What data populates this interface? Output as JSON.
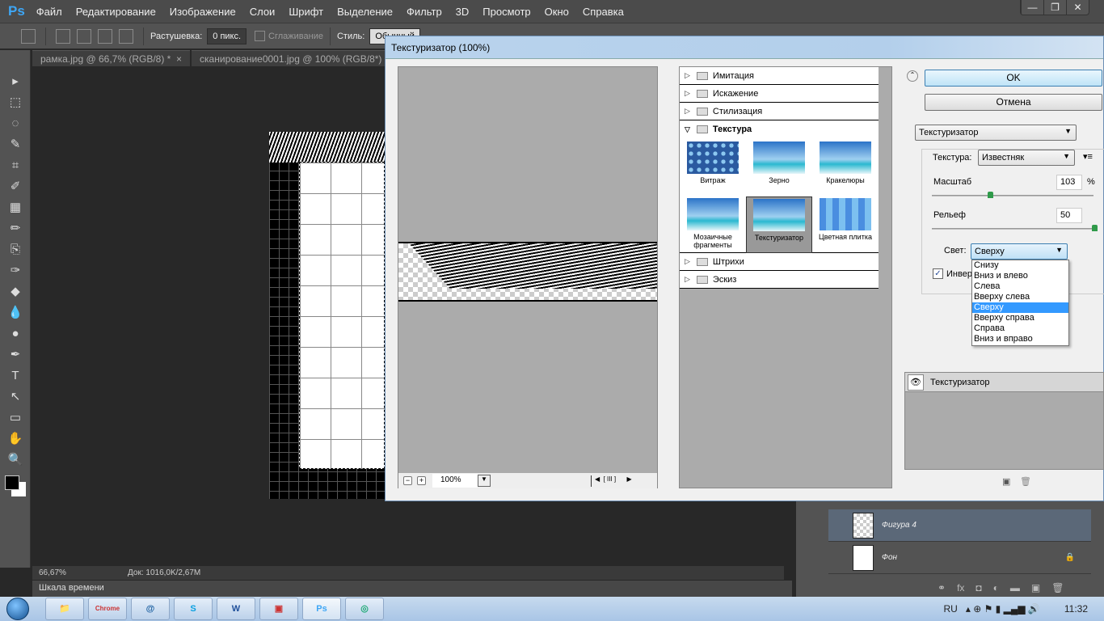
{
  "app": {
    "logo": "Ps",
    "menu": [
      "Файл",
      "Редактирование",
      "Изображение",
      "Слои",
      "Шрифт",
      "Выделение",
      "Фильтр",
      "3D",
      "Просмотр",
      "Окно",
      "Справка"
    ],
    "window_controls": [
      "—",
      "❐",
      "✕"
    ]
  },
  "options": {
    "feather_label": "Растушевка:",
    "feather_value": "0 пикс.",
    "antialias_label": "Сглаживание",
    "style_label": "Стиль:",
    "style_value": "Обычный"
  },
  "tabs": [
    {
      "label": "рамка.jpg @ 66,7% (RGB/8) *",
      "close": "×"
    },
    {
      "label": "сканирование0001.jpg @ 100% (RGB/8*)",
      "close": "×"
    }
  ],
  "tools": [
    "▸",
    "⬚",
    "◌",
    "✎",
    "⌗",
    "✐",
    "▦",
    "✏",
    "⎘",
    "✑",
    "◆",
    "💧",
    "●",
    "✒",
    "T",
    "↖",
    "▭",
    "✋",
    "🔍"
  ],
  "status": {
    "zoom": "66,67%",
    "doc": "Док: 1016,0K/2,67M"
  },
  "timeline": {
    "label": "Шкала времени"
  },
  "layers": [
    {
      "name": "Фигура 4",
      "selected": true
    },
    {
      "name": "Фон",
      "locked": true
    }
  ],
  "layer_icons": [
    "⚭",
    "fx",
    "◘",
    "◐",
    "▬",
    "▣",
    "🗑"
  ],
  "dialog": {
    "title": "Текстуризатор (100%)",
    "preview_zoom": "100%",
    "categories_before": [
      "Имитация",
      "Искажение",
      "Стилизация"
    ],
    "open_category": "Текстура",
    "filters": [
      {
        "label": "Витраж"
      },
      {
        "label": "Зерно"
      },
      {
        "label": "Кракелюры"
      },
      {
        "label": "Мозаичные фрагменты"
      },
      {
        "label": "Текстуризатор",
        "selected": true
      },
      {
        "label": "Цветная плитка"
      }
    ],
    "categories_after": [
      "Штрихи",
      "Эскиз"
    ],
    "ok": "OK",
    "cancel": "Отмена",
    "filter_select": "Текстуризатор",
    "texture_label": "Текстура:",
    "texture_value": "Известняк",
    "scale_label": "Масштаб",
    "scale_value": "103",
    "scale_unit": "%",
    "relief_label": "Рельеф",
    "relief_value": "50",
    "light_label": "Свет:",
    "light_value": "Сверху",
    "light_options": [
      "Снизу",
      "Вниз и влево",
      "Слева",
      "Вверху слева",
      "Сверху",
      "Вверху справа",
      "Справа",
      "Вниз и вправо"
    ],
    "invert_label": "Инверсия",
    "invert_checked": true,
    "effect_layer": "Текстуризатор"
  },
  "taskbar": {
    "apps": [
      "📁",
      "Chrome",
      "@",
      "S",
      "W",
      "▣",
      "Ps",
      "◎"
    ],
    "lang": "RU",
    "time": "11:32"
  }
}
